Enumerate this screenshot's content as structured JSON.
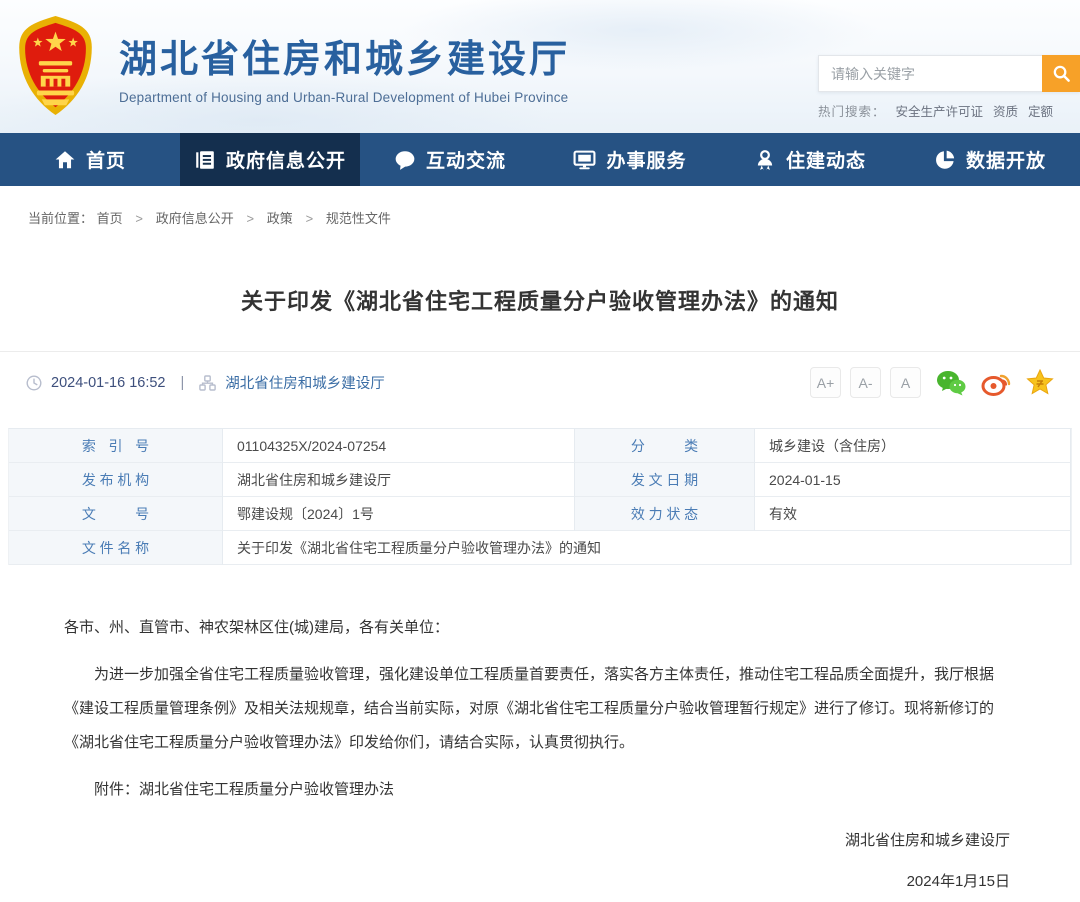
{
  "header": {
    "site_title": "湖北省住房和城乡建设厅",
    "site_subtitle": "Department of Housing and Urban-Rural Development of Hubei Province",
    "search": {
      "placeholder": "请输入关键字"
    },
    "hot_search": {
      "label": "热门搜索：",
      "keywords": [
        "安全生产许可证",
        "资质",
        "定额"
      ]
    }
  },
  "nav": {
    "items": [
      {
        "label": "首页",
        "icon": "home-icon",
        "active": false
      },
      {
        "label": "政府信息公开",
        "icon": "document-icon",
        "active": true
      },
      {
        "label": "互动交流",
        "icon": "chat-bubble-icon",
        "active": false
      },
      {
        "label": "办事服务",
        "icon": "monitor-icon",
        "active": false
      },
      {
        "label": "住建动态",
        "icon": "medal-person-icon",
        "active": false
      },
      {
        "label": "数据开放",
        "icon": "pie-chart-icon",
        "active": false
      }
    ]
  },
  "breadcrumb": {
    "label": "当前位置：",
    "separator": ">",
    "items": [
      "首页",
      "政府信息公开",
      "政策",
      "规范性文件"
    ]
  },
  "article": {
    "title": "关于印发《湖北省住宅工程质量分户验收管理办法》的通知",
    "publish_time": "2024-01-16 16:52",
    "divider": "|",
    "source": "湖北省住房和城乡建设厅",
    "font_size_controls": [
      "A+",
      "A-",
      "A"
    ],
    "share_icons": [
      "wechat-icon",
      "weibo-icon",
      "favorite-star-icon"
    ],
    "meta": {
      "rows": [
        {
          "label": "索引号",
          "value": "01104325X/2024-07254",
          "label2": "分类",
          "value2": "城乡建设（含住房）"
        },
        {
          "label": "发布机构",
          "value": "湖北省住房和城乡建设厅",
          "label2": "发文日期",
          "value2": "2024-01-15"
        },
        {
          "label": "文号",
          "value": "鄂建设规〔2024〕1号",
          "label2": "效力状态",
          "value2": "有效"
        },
        {
          "label": "文件名称",
          "value": "关于印发《湖北省住宅工程质量分户验收管理办法》的通知"
        }
      ]
    },
    "body": {
      "salutation": "各市、州、直管市、神农架林区住(城)建局，各有关单位：",
      "paragraph": "为进一步加强全省住宅工程质量验收管理，强化建设单位工程质量首要责任，落实各方主体责任，推动住宅工程品质全面提升，我厅根据《建设工程质量管理条例》及相关法规规章，结合当前实际，对原《湖北省住宅工程质量分户验收管理暂行规定》进行了修订。现将新修订的《湖北省住宅工程质量分户验收管理办法》印发给你们，请结合实际，认真贯彻执行。",
      "attachment": "附件：湖北省住宅工程质量分户验收管理办法"
    },
    "signature": {
      "org": "湖北省住房和城乡建设厅",
      "date": "2024年1月15日"
    }
  },
  "colors": {
    "brand_blue": "#28609f",
    "nav_blue": "#265283",
    "nav_active_blue": "#142f4e",
    "accent_orange": "#f7a128",
    "link_blue": "#3a6da5",
    "meta_label_blue": "#4a7cb5",
    "wechat_green": "#4fbc3c",
    "weibo_orange": "#e6592c",
    "star_gold": "#f7c31d"
  }
}
